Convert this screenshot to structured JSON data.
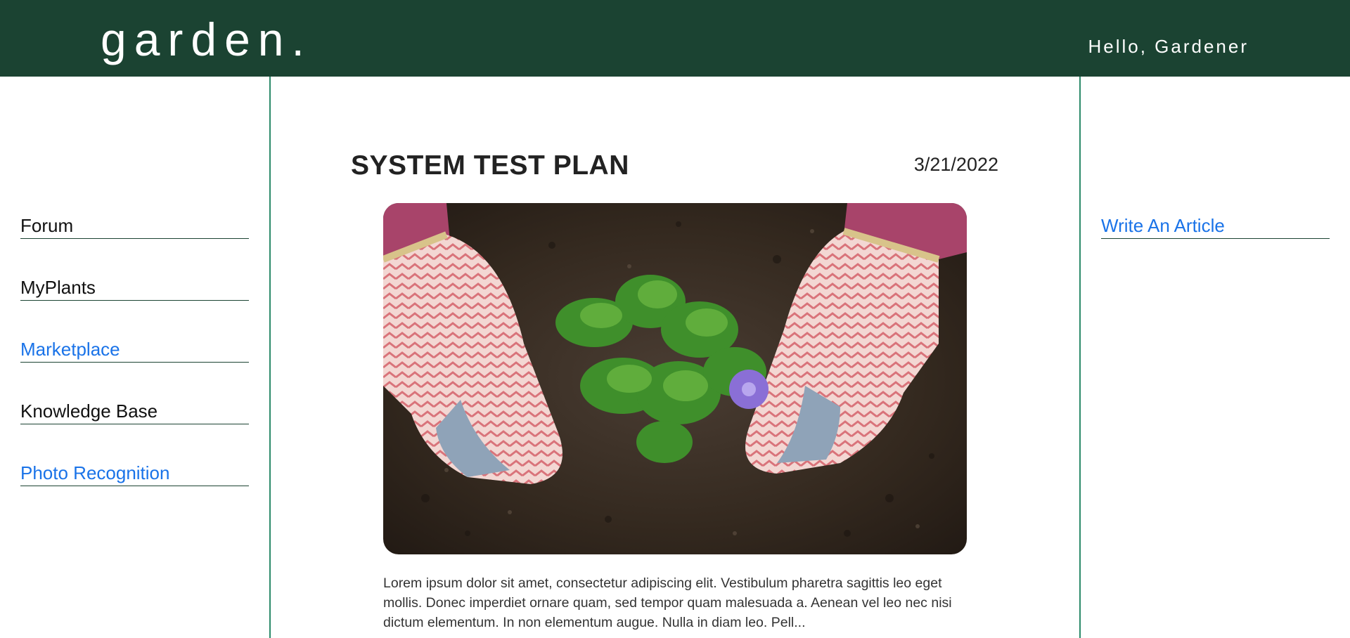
{
  "header": {
    "logo": "garden.",
    "greeting": "Hello, Gardener",
    "background_color": "#1b4332"
  },
  "sidebar": {
    "items": [
      {
        "label": "Forum",
        "style": "default"
      },
      {
        "label": "MyPlants",
        "style": "default"
      },
      {
        "label": "Marketplace",
        "style": "link"
      },
      {
        "label": "Knowledge Base",
        "style": "default"
      },
      {
        "label": "Photo Recognition",
        "style": "link"
      }
    ]
  },
  "right_panel": {
    "write_article_label": "Write An Article"
  },
  "article": {
    "title": "SYSTEM TEST PLAN",
    "date": "3/21/2022",
    "image_icon": "gardening-gloves-seedling-photo",
    "excerpt": "Lorem ipsum dolor sit amet, consectetur adipiscing elit. Vestibulum pharetra sagittis leo eget mollis. Donec imperdiet ornare quam, sed tempor quam malesuada a. Aenean vel leo nec nisi dictum elementum. In non elementum augue. Nulla in diam leo. Pell..."
  },
  "colors": {
    "accent_link": "#1a73e8",
    "divider": "#2d8a6a",
    "brand_dark_green": "#1b4332"
  }
}
